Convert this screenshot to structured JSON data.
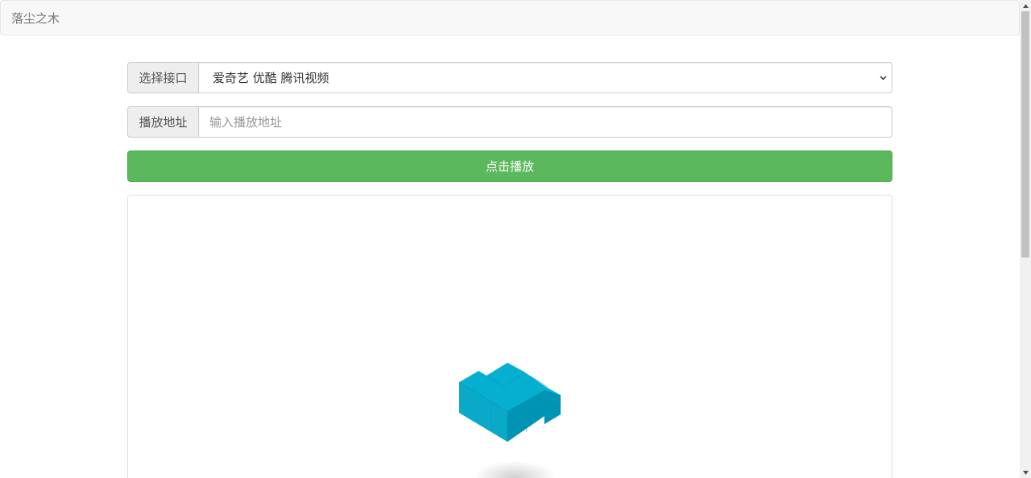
{
  "navbar": {
    "brand": "落尘之木"
  },
  "interface": {
    "label": "选择接口",
    "selected": "爱奇艺 优酷 腾讯视频"
  },
  "address": {
    "label": "播放地址",
    "placeholder": "输入播放地址",
    "value": ""
  },
  "play_button": {
    "label": "点击播放"
  },
  "player": {
    "loader_color": "#06afd0",
    "loader_shade": "#0099b9"
  },
  "colors": {
    "success": "#5cb85c",
    "navbar_bg": "#f8f8f8"
  },
  "icons": {
    "select": "chevron-down-icon",
    "scroll_up": "scroll-up-arrow",
    "scroll_down": "scroll-down-arrow"
  }
}
